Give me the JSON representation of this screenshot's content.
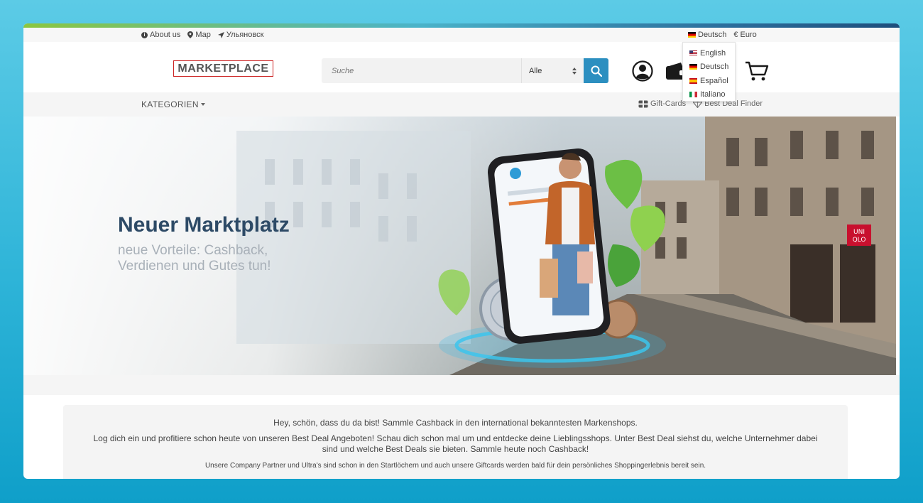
{
  "topbar": {
    "about": "About us",
    "map": "Map",
    "location": "Ульяновск",
    "language": "Deutsch",
    "currency": "€ Euro"
  },
  "header": {
    "logo": "MARKETPLACE",
    "search_placeholder": "Suche",
    "search_category": "Alle"
  },
  "language_menu": {
    "options": [
      "English",
      "Deutsch",
      "Español",
      "Italiano"
    ]
  },
  "nav": {
    "categories": "KATEGORIEN",
    "gift_cards": "Gift-Cards",
    "best_deal": "Best Deal Finder"
  },
  "hero": {
    "title": "Neuer Marktplatz",
    "subtitle": "neue Vorteile: Cashback, Verdienen und Gutes tun!"
  },
  "info": {
    "line1": "Hey, schön, dass du da bist! Sammle Cashback in den international bekanntesten Markenshops.",
    "line2": "Log dich ein und profitiere schon heute von unseren Best Deal Angeboten! Schau dich schon mal um und entdecke deine Lieblingsshops. Unter Best Deal siehst du, welche Unternehmer dabei sind und welche Best Deals sie bieten. Sammle heute noch Cashback!",
    "line3": "Unsere Company Partner und Ultra's sind schon in den Startlöchern und auch unsere Giftcards werden bald für dein persönliches Shoppingerlebnis bereit sein."
  },
  "colors": {
    "brand_blue": "#2c8fc0",
    "title_navy": "#2d4a66",
    "logo_border": "#cc2222"
  }
}
